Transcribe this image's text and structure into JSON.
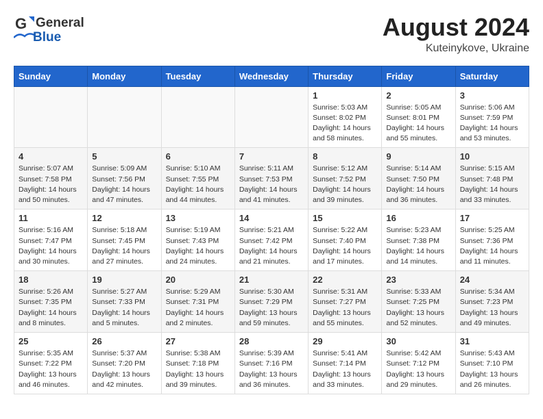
{
  "header": {
    "logo_general": "General",
    "logo_blue": "Blue",
    "month_year": "August 2024",
    "location": "Kuteinykove, Ukraine"
  },
  "weekdays": [
    "Sunday",
    "Monday",
    "Tuesday",
    "Wednesday",
    "Thursday",
    "Friday",
    "Saturday"
  ],
  "weeks": [
    [
      {
        "day": "",
        "empty": true
      },
      {
        "day": "",
        "empty": true
      },
      {
        "day": "",
        "empty": true
      },
      {
        "day": "",
        "empty": true
      },
      {
        "day": "1",
        "sunrise": "5:03 AM",
        "sunset": "8:02 PM",
        "daylight": "14 hours and 58 minutes."
      },
      {
        "day": "2",
        "sunrise": "5:05 AM",
        "sunset": "8:01 PM",
        "daylight": "14 hours and 55 minutes."
      },
      {
        "day": "3",
        "sunrise": "5:06 AM",
        "sunset": "7:59 PM",
        "daylight": "14 hours and 53 minutes."
      }
    ],
    [
      {
        "day": "4",
        "sunrise": "5:07 AM",
        "sunset": "7:58 PM",
        "daylight": "14 hours and 50 minutes."
      },
      {
        "day": "5",
        "sunrise": "5:09 AM",
        "sunset": "7:56 PM",
        "daylight": "14 hours and 47 minutes."
      },
      {
        "day": "6",
        "sunrise": "5:10 AM",
        "sunset": "7:55 PM",
        "daylight": "14 hours and 44 minutes."
      },
      {
        "day": "7",
        "sunrise": "5:11 AM",
        "sunset": "7:53 PM",
        "daylight": "14 hours and 41 minutes."
      },
      {
        "day": "8",
        "sunrise": "5:12 AM",
        "sunset": "7:52 PM",
        "daylight": "14 hours and 39 minutes."
      },
      {
        "day": "9",
        "sunrise": "5:14 AM",
        "sunset": "7:50 PM",
        "daylight": "14 hours and 36 minutes."
      },
      {
        "day": "10",
        "sunrise": "5:15 AM",
        "sunset": "7:48 PM",
        "daylight": "14 hours and 33 minutes."
      }
    ],
    [
      {
        "day": "11",
        "sunrise": "5:16 AM",
        "sunset": "7:47 PM",
        "daylight": "14 hours and 30 minutes."
      },
      {
        "day": "12",
        "sunrise": "5:18 AM",
        "sunset": "7:45 PM",
        "daylight": "14 hours and 27 minutes."
      },
      {
        "day": "13",
        "sunrise": "5:19 AM",
        "sunset": "7:43 PM",
        "daylight": "14 hours and 24 minutes."
      },
      {
        "day": "14",
        "sunrise": "5:21 AM",
        "sunset": "7:42 PM",
        "daylight": "14 hours and 21 minutes."
      },
      {
        "day": "15",
        "sunrise": "5:22 AM",
        "sunset": "7:40 PM",
        "daylight": "14 hours and 17 minutes."
      },
      {
        "day": "16",
        "sunrise": "5:23 AM",
        "sunset": "7:38 PM",
        "daylight": "14 hours and 14 minutes."
      },
      {
        "day": "17",
        "sunrise": "5:25 AM",
        "sunset": "7:36 PM",
        "daylight": "14 hours and 11 minutes."
      }
    ],
    [
      {
        "day": "18",
        "sunrise": "5:26 AM",
        "sunset": "7:35 PM",
        "daylight": "14 hours and 8 minutes."
      },
      {
        "day": "19",
        "sunrise": "5:27 AM",
        "sunset": "7:33 PM",
        "daylight": "14 hours and 5 minutes."
      },
      {
        "day": "20",
        "sunrise": "5:29 AM",
        "sunset": "7:31 PM",
        "daylight": "14 hours and 2 minutes."
      },
      {
        "day": "21",
        "sunrise": "5:30 AM",
        "sunset": "7:29 PM",
        "daylight": "13 hours and 59 minutes."
      },
      {
        "day": "22",
        "sunrise": "5:31 AM",
        "sunset": "7:27 PM",
        "daylight": "13 hours and 55 minutes."
      },
      {
        "day": "23",
        "sunrise": "5:33 AM",
        "sunset": "7:25 PM",
        "daylight": "13 hours and 52 minutes."
      },
      {
        "day": "24",
        "sunrise": "5:34 AM",
        "sunset": "7:23 PM",
        "daylight": "13 hours and 49 minutes."
      }
    ],
    [
      {
        "day": "25",
        "sunrise": "5:35 AM",
        "sunset": "7:22 PM",
        "daylight": "13 hours and 46 minutes."
      },
      {
        "day": "26",
        "sunrise": "5:37 AM",
        "sunset": "7:20 PM",
        "daylight": "13 hours and 42 minutes."
      },
      {
        "day": "27",
        "sunrise": "5:38 AM",
        "sunset": "7:18 PM",
        "daylight": "13 hours and 39 minutes."
      },
      {
        "day": "28",
        "sunrise": "5:39 AM",
        "sunset": "7:16 PM",
        "daylight": "13 hours and 36 minutes."
      },
      {
        "day": "29",
        "sunrise": "5:41 AM",
        "sunset": "7:14 PM",
        "daylight": "13 hours and 33 minutes."
      },
      {
        "day": "30",
        "sunrise": "5:42 AM",
        "sunset": "7:12 PM",
        "daylight": "13 hours and 29 minutes."
      },
      {
        "day": "31",
        "sunrise": "5:43 AM",
        "sunset": "7:10 PM",
        "daylight": "13 hours and 26 minutes."
      }
    ]
  ],
  "labels": {
    "sunrise": "Sunrise:",
    "sunset": "Sunset:",
    "daylight": "Daylight:"
  }
}
